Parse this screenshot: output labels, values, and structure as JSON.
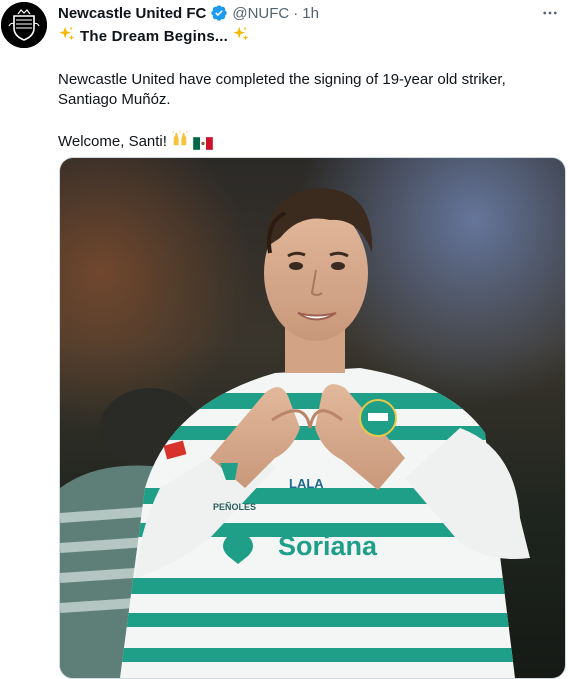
{
  "account": {
    "name": "Newcastle United FC",
    "handle": "@NUFC",
    "separator": "·",
    "time": "1h",
    "verified": true
  },
  "tweet": {
    "headline": "The Dream Begins...",
    "body": "Newcastle United have completed the signing of 19-year old striker, Santiago Muñóz.",
    "welcome": "Welcome, Santi!"
  },
  "media": {
    "jersey_text": "Soriana",
    "sponsor_small": "LALA",
    "sponsor_small2": "PEÑOLES"
  },
  "colors": {
    "verified_blue": "#1d9bf0",
    "jersey_green": "#1f9f87",
    "text_primary": "#0f1419",
    "text_secondary": "#536471"
  },
  "icons": {
    "more": "more-horizontal-icon",
    "verified": "verified-badge-icon",
    "sparkles": "sparkles-icon",
    "raised_hands": "raised-hands-icon",
    "flag": "mexico-flag-icon"
  }
}
